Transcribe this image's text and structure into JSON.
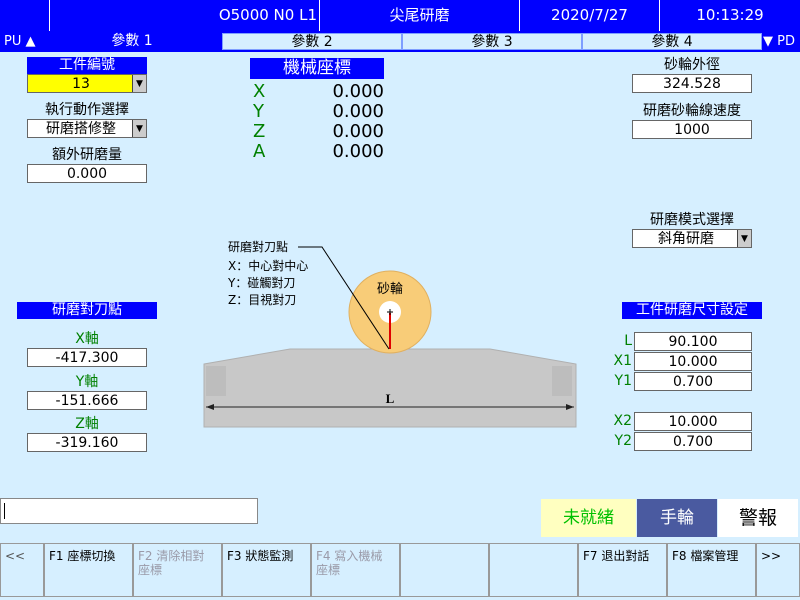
{
  "topbar": {
    "program": "O5000 N0 L1",
    "title": "尖尾研磨",
    "date": "2020/7/27",
    "time": "10:13:29"
  },
  "tabs": {
    "left": "PU ▲",
    "right": "▼ PD",
    "items": [
      "參數 1",
      "參數 2",
      "參數 3",
      "參數 4"
    ]
  },
  "left_panel": {
    "workpiece_no_label": "工件編號",
    "workpiece_no_value": "13",
    "action_label": "執行動作選擇",
    "action_value": "研磨搭修整",
    "extra_grind_label": "額外研磨量",
    "extra_grind_value": "0.000",
    "touch_title": "研磨對刀點",
    "x_axis_label": "X軸",
    "x_axis_value": "-417.300",
    "y_axis_label": "Y軸",
    "y_axis_value": "-151.666",
    "z_axis_label": "Z軸",
    "z_axis_value": "-319.160"
  },
  "machine_coords": {
    "title": "機械座標",
    "axes": [
      {
        "name": "X",
        "value": "0.000"
      },
      {
        "name": "Y",
        "value": "0.000"
      },
      {
        "name": "Z",
        "value": "0.000"
      },
      {
        "name": "A",
        "value": "0.000"
      }
    ]
  },
  "right_panel": {
    "wheel_od_label": "砂輪外徑",
    "wheel_od_value": "324.528",
    "wheel_speed_label": "研磨砂輪線速度",
    "wheel_speed_value": "1000",
    "mode_label": "研磨模式選擇",
    "mode_value": "斜角研磨",
    "size_title": "工件研磨尺寸設定",
    "L_label": "L",
    "L_value": "90.100",
    "X1_label": "X1",
    "X1_value": "10.000",
    "Y1_label": "Y1",
    "Y1_value": "0.700",
    "X2_label": "X2",
    "X2_value": "10.000",
    "Y2_label": "Y2",
    "Y2_value": "0.700"
  },
  "diagram": {
    "callout_title": "研磨對刀點",
    "callout_x": "X：中心對中心",
    "callout_y": "Y：碰觸對刀",
    "callout_z": "Z：目視對刀",
    "wheel_label": "砂輪",
    "dim_label": "L",
    "wheel_color": "#f8cc78",
    "workpiece_color": "#c8c8c8"
  },
  "status": {
    "not_ready": "未就緒",
    "handwheel": "手輪",
    "alarm": "警報",
    "not_ready_color": "#00c000",
    "handwheel_bg": "#4a5aa0"
  },
  "fkeys": [
    {
      "label": "<<",
      "enabled": true
    },
    {
      "label": "F1 座標切換",
      "enabled": true
    },
    {
      "label": "F2 清除相對 座標",
      "enabled": false
    },
    {
      "label": "F3 狀態監測",
      "enabled": true
    },
    {
      "label": "F4 寫入機械 座標",
      "enabled": false
    },
    {
      "label": "",
      "enabled": false
    },
    {
      "label": "",
      "enabled": false
    },
    {
      "label": "F7 退出對話",
      "enabled": true
    },
    {
      "label": "F8 檔案管理",
      "enabled": true
    },
    {
      "label": ">>",
      "enabled": true
    }
  ]
}
